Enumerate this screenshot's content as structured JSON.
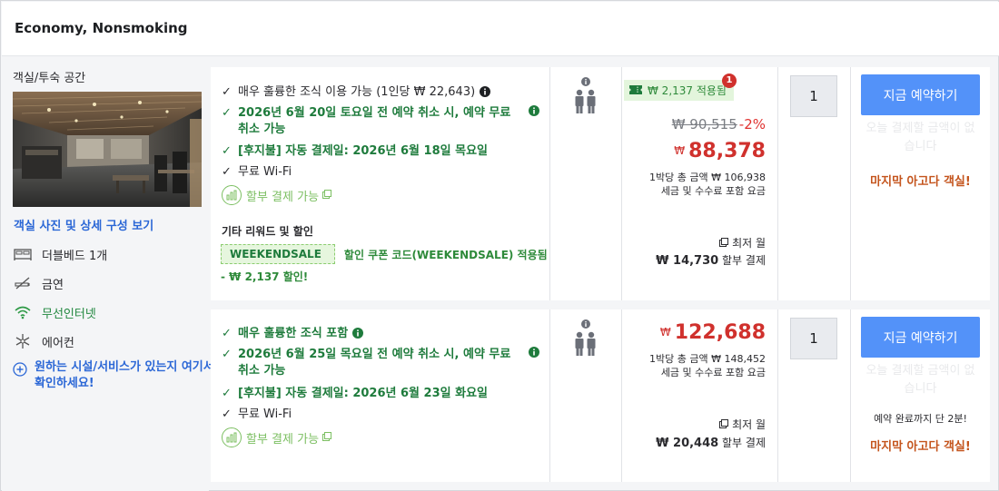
{
  "header": {
    "title": "Economy, Nonsmoking"
  },
  "room": {
    "label": "객실/투숙 공간",
    "photo_link": "객실 사진 및 상세 구성 보기",
    "amenities": [
      {
        "icon": "bed-icon",
        "label": "더블베드 1개"
      },
      {
        "icon": "no-smoking-icon",
        "label": "금연"
      },
      {
        "icon": "wifi-icon",
        "label": "무선인터넷"
      },
      {
        "icon": "snowflake-icon",
        "label": "에어컨"
      }
    ],
    "facility_link": "원하는 시설/서비스가 있는지 여기서 확인하세요!"
  },
  "offers": [
    {
      "benefits": [
        "매우 훌륭한 조식 이용 가능 (1인당 ₩ 22,643)",
        "2026년 6월 20일 토요일 전 예약 취소 시, 예약 무료 취소 가능",
        "[후지불] 자동 결제일: 2026년 6월 18일 목요일",
        "무료 Wi-Fi"
      ],
      "installment": "할부 결제 가능",
      "reward_title": "기타 리워드 및 할인",
      "coupon_code": "WEEKENDSALE",
      "coupon_text": "할인 쿠폰 코드(WEEKENDSALE) 적용됨",
      "coupon_sub": "- ₩ 2,137 할인!",
      "applied_badge": "₩ 2,137 적용됨",
      "notification_count": "1",
      "original_price": "₩ 90,515",
      "discount": "-2%",
      "currency": "₩",
      "price": "88,378",
      "total_line": "1박당 총 금액 ₩ 106,938",
      "tax_line": "세금 및 수수료 포함 요금",
      "min_month": "최저 월",
      "monthly_amount": "₩ 14,730",
      "monthly_suffix": "할부 결제",
      "quantity": "1",
      "book_label": "지금 예약하기",
      "pay_note": "오늘 결제할 금액이 없습니다",
      "last_room": "마지막 아고다 객실!"
    },
    {
      "benefits": [
        "매우 훌륭한 조식 포함",
        "2026년 6월 25일 목요일 전 예약 취소 시, 예약 무료 취소 가능",
        "[후지불] 자동 결제일: 2026년 6월 23일 화요일",
        "무료 Wi-Fi"
      ],
      "installment": "할부 결제 가능",
      "currency": "₩",
      "price": "122,688",
      "total_line": "1박당 총 금액 ₩ 148,452",
      "tax_line": "세금 및 수수료 포함 요금",
      "min_month": "최저 월",
      "monthly_amount": "₩ 20,448",
      "monthly_suffix": "할부 결제",
      "quantity": "1",
      "book_label": "지금 예약하기",
      "pay_note": "오늘 결제할 금액이 없습니다",
      "remain_note": "예약 완료까지 단 2분!",
      "last_room": "마지막 아고다 객실!"
    }
  ]
}
